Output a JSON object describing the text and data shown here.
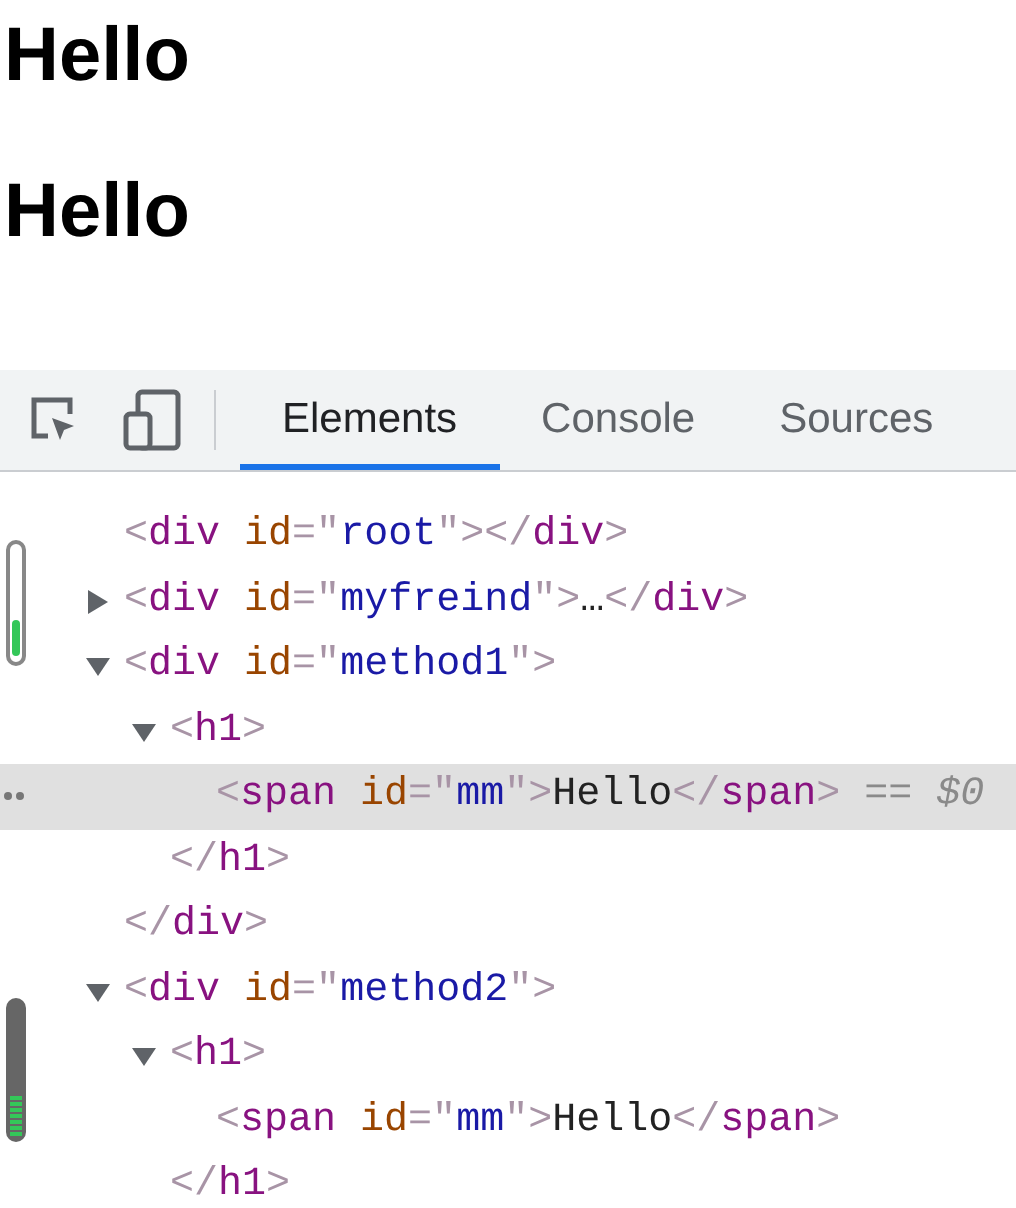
{
  "page": {
    "headings": [
      "Hello",
      "Hello"
    ]
  },
  "devtools": {
    "tabs": [
      {
        "label": "Elements",
        "selected": true
      },
      {
        "label": "Console",
        "selected": false
      },
      {
        "label": "Sources",
        "selected": false
      }
    ],
    "tree": [
      {
        "selected": false,
        "tokens": [
          {
            "kind": "punct",
            "text": "<"
          },
          {
            "kind": "tag",
            "text": "div"
          },
          {
            "kind": "attr",
            "text": "id"
          },
          {
            "kind": "punct",
            "text": "=\""
          },
          {
            "kind": "value",
            "text": "root"
          },
          {
            "kind": "punct",
            "text": "\"></"
          },
          {
            "kind": "tag",
            "text": "div"
          },
          {
            "kind": "punct",
            "text": ">"
          }
        ]
      },
      {
        "selected": false,
        "expanded": false,
        "tokens": [
          {
            "kind": "punct",
            "text": "<"
          },
          {
            "kind": "tag",
            "text": "div"
          },
          {
            "kind": "attr",
            "text": "id"
          },
          {
            "kind": "punct",
            "text": "=\""
          },
          {
            "kind": "value",
            "text": "myfreind"
          },
          {
            "kind": "punct",
            "text": "\">"
          },
          {
            "kind": "text",
            "text": "…"
          },
          {
            "kind": "punct",
            "text": "</"
          },
          {
            "kind": "tag",
            "text": "div"
          },
          {
            "kind": "punct",
            "text": ">"
          }
        ]
      },
      {
        "selected": false,
        "expanded": true,
        "tokens": [
          {
            "kind": "punct",
            "text": "<"
          },
          {
            "kind": "tag",
            "text": "div"
          },
          {
            "kind": "attr",
            "text": "id"
          },
          {
            "kind": "punct",
            "text": "=\""
          },
          {
            "kind": "value",
            "text": "method1"
          },
          {
            "kind": "punct",
            "text": "\">"
          }
        ],
        "children": [
          {
            "selected": false,
            "expanded": true,
            "tokens": [
              {
                "kind": "punct",
                "text": "<"
              },
              {
                "kind": "tag",
                "text": "h1"
              },
              {
                "kind": "punct",
                "text": ">"
              }
            ],
            "children": [
              {
                "selected": true,
                "tokens": [
                  {
                    "kind": "punct",
                    "text": "<"
                  },
                  {
                    "kind": "tag",
                    "text": "span"
                  },
                  {
                    "kind": "attr",
                    "text": "id"
                  },
                  {
                    "kind": "punct",
                    "text": "=\""
                  },
                  {
                    "kind": "value",
                    "text": "mm"
                  },
                  {
                    "kind": "punct",
                    "text": "\">"
                  },
                  {
                    "kind": "text",
                    "text": "Hello"
                  },
                  {
                    "kind": "punct",
                    "text": "</"
                  },
                  {
                    "kind": "tag",
                    "text": "span"
                  },
                  {
                    "kind": "punct",
                    "text": ">"
                  },
                  {
                    "kind": "marker",
                    "text": "== $0"
                  }
                ]
              }
            ],
            "close": [
              {
                "kind": "punct",
                "text": "</"
              },
              {
                "kind": "tag",
                "text": "h1"
              },
              {
                "kind": "punct",
                "text": ">"
              }
            ]
          }
        ],
        "close": [
          {
            "kind": "punct",
            "text": "</"
          },
          {
            "kind": "tag",
            "text": "div"
          },
          {
            "kind": "punct",
            "text": ">"
          }
        ]
      },
      {
        "selected": false,
        "expanded": true,
        "tokens": [
          {
            "kind": "punct",
            "text": "<"
          },
          {
            "kind": "tag",
            "text": "div"
          },
          {
            "kind": "attr",
            "text": "id"
          },
          {
            "kind": "punct",
            "text": "=\""
          },
          {
            "kind": "value",
            "text": "method2"
          },
          {
            "kind": "punct",
            "text": "\">"
          }
        ],
        "children": [
          {
            "selected": false,
            "expanded": true,
            "tokens": [
              {
                "kind": "punct",
                "text": "<"
              },
              {
                "kind": "tag",
                "text": "h1"
              },
              {
                "kind": "punct",
                "text": ">"
              }
            ],
            "children": [
              {
                "selected": false,
                "tokens": [
                  {
                    "kind": "punct",
                    "text": "<"
                  },
                  {
                    "kind": "tag",
                    "text": "span"
                  },
                  {
                    "kind": "attr",
                    "text": "id"
                  },
                  {
                    "kind": "punct",
                    "text": "=\""
                  },
                  {
                    "kind": "value",
                    "text": "mm"
                  },
                  {
                    "kind": "punct",
                    "text": "\">"
                  },
                  {
                    "kind": "text",
                    "text": "Hello"
                  },
                  {
                    "kind": "punct",
                    "text": "</"
                  },
                  {
                    "kind": "tag",
                    "text": "span"
                  },
                  {
                    "kind": "punct",
                    "text": ">"
                  }
                ]
              }
            ],
            "close": [
              {
                "kind": "punct",
                "text": "</"
              },
              {
                "kind": "tag",
                "text": "h1"
              },
              {
                "kind": "punct",
                "text": ">"
              }
            ]
          }
        ]
      }
    ]
  }
}
